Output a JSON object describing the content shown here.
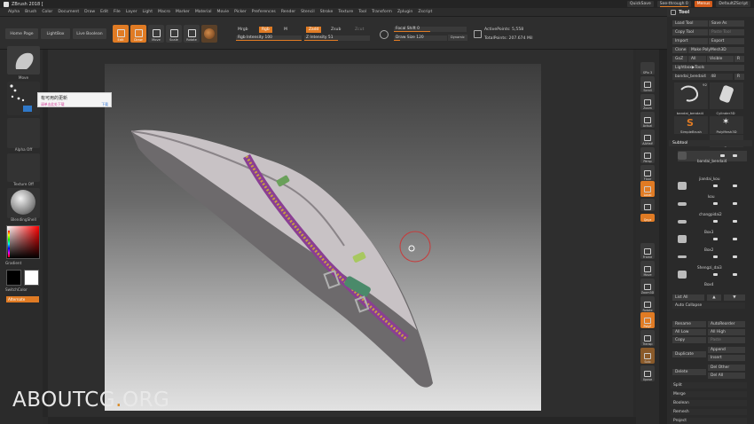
{
  "app": {
    "title": "ZBrush 2018 [",
    "quicksave": "QuickSave",
    "see_through": "See-through 0",
    "menus": "Menus",
    "default_script": "DefaultZScript"
  },
  "menubar": {
    "items": [
      "Alpha",
      "Brush",
      "Color",
      "Document",
      "Draw",
      "Edit",
      "File",
      "Layer",
      "Light",
      "Macro",
      "Marker",
      "Material",
      "Movie",
      "Picker",
      "Preferences",
      "Render",
      "Stencil",
      "Stroke",
      "Texture",
      "Tool",
      "Transform",
      "Zplugin",
      "Zscript"
    ]
  },
  "tool_panel": {
    "title": "Tool",
    "load_tool": "Load Tool",
    "save_as": "Save As",
    "copy_tool": "Copy Tool",
    "paste_tool": "Paste Tool",
    "import": "Import",
    "export": "Export",
    "clone": "Clone",
    "make_polymesh": "Make PolyMesh3D",
    "goz": "GoZ",
    "all": "All",
    "visible": "Visible",
    "r": "R",
    "lightbox_tools": "Lightbox▶Tools",
    "current_tool": "bandai_bendai4",
    "current_count": "48",
    "tools": [
      {
        "name": "bandai_bendai4",
        "count": "92"
      },
      {
        "name": "Cylinder3D",
        "count": ""
      },
      {
        "name": "SimpleBrush",
        "count": ""
      },
      {
        "name": "PolyMesh3D",
        "count": ""
      },
      {
        "name": "bandai_bendai4",
        "count": "92"
      }
    ],
    "subtool_header": "Subtool",
    "subtools": [
      "bandai_bendai4",
      "jiandai_kou",
      "kou",
      "changpidai2",
      "Box3",
      "Box2",
      "Shengzi_dai3",
      "Box4"
    ],
    "list_all": "List All",
    "auto_collapse": "Auto Collapse",
    "rename": "Rename",
    "autoreorder": "AutoReorder",
    "all_low": "All Low",
    "all_high": "All High",
    "copy": "Copy",
    "paste": "Paste",
    "duplicate": "Duplicate",
    "append": "Append",
    "insert": "Insert",
    "delete": "Delete",
    "del_other": "Del Other",
    "del_all": "Del All",
    "split": "Split",
    "merge": "Merge",
    "boolean": "Boolean",
    "remesh": "Remesh",
    "project": "Project"
  },
  "topshelf": {
    "home_page": "Home Page",
    "lightbox": "LightBox",
    "live_boolean": "Live Boolean",
    "edit": "Edit",
    "draw": "Draw",
    "move": "Move",
    "scale": "Scale",
    "rotate": "Rotate",
    "mrgb": "Mrgb",
    "rgb": "Rgb",
    "m": "M",
    "rgb_intensity_label": "Rgb Intensity",
    "rgb_intensity": "100",
    "zadd": "Zadd",
    "zsub": "Zsub",
    "zcut": "Zcut",
    "z_intensity_label": "Z Intensity",
    "z_intensity": "51",
    "focal_shift_label": "Focal Shift",
    "focal_shift": "0",
    "draw_size_label": "Draw Size",
    "draw_size": "120",
    "dynamic": "Dynamic",
    "active_points": "ActivePoints: 5,558",
    "total_points": "TotalPoints: 207.674 Mil"
  },
  "leftshelf": {
    "move": "Move",
    "alpha_off": "Alpha Off",
    "texture_off": "Texture Off",
    "material": "BlendingShell",
    "gradient": "Gradient",
    "switch_color": "SwitchColor",
    "alternate": "Alternate"
  },
  "tooltip": {
    "title": "有可用的更新",
    "subtitle": "请单击此处下载",
    "link": "下载"
  },
  "rightshelf": {
    "buttons": [
      "SPix 3",
      "Scroll",
      "Zoom",
      "Actual",
      "AAHalf",
      "Persp",
      "Floor",
      "Local",
      "Frame",
      "Move",
      "Zoom3D",
      "Rotate",
      "PolyF",
      "Transp",
      "Solo",
      "Xpose"
    ],
    "xyz": "Qxyz"
  },
  "watermark": {
    "brand": "ABOUTCG",
    "dot": ".",
    "tld": "ORG"
  },
  "colors": {
    "accent": "#e07b24",
    "bg": "#2a2a2a",
    "panel_button": "#3c3c3c"
  }
}
